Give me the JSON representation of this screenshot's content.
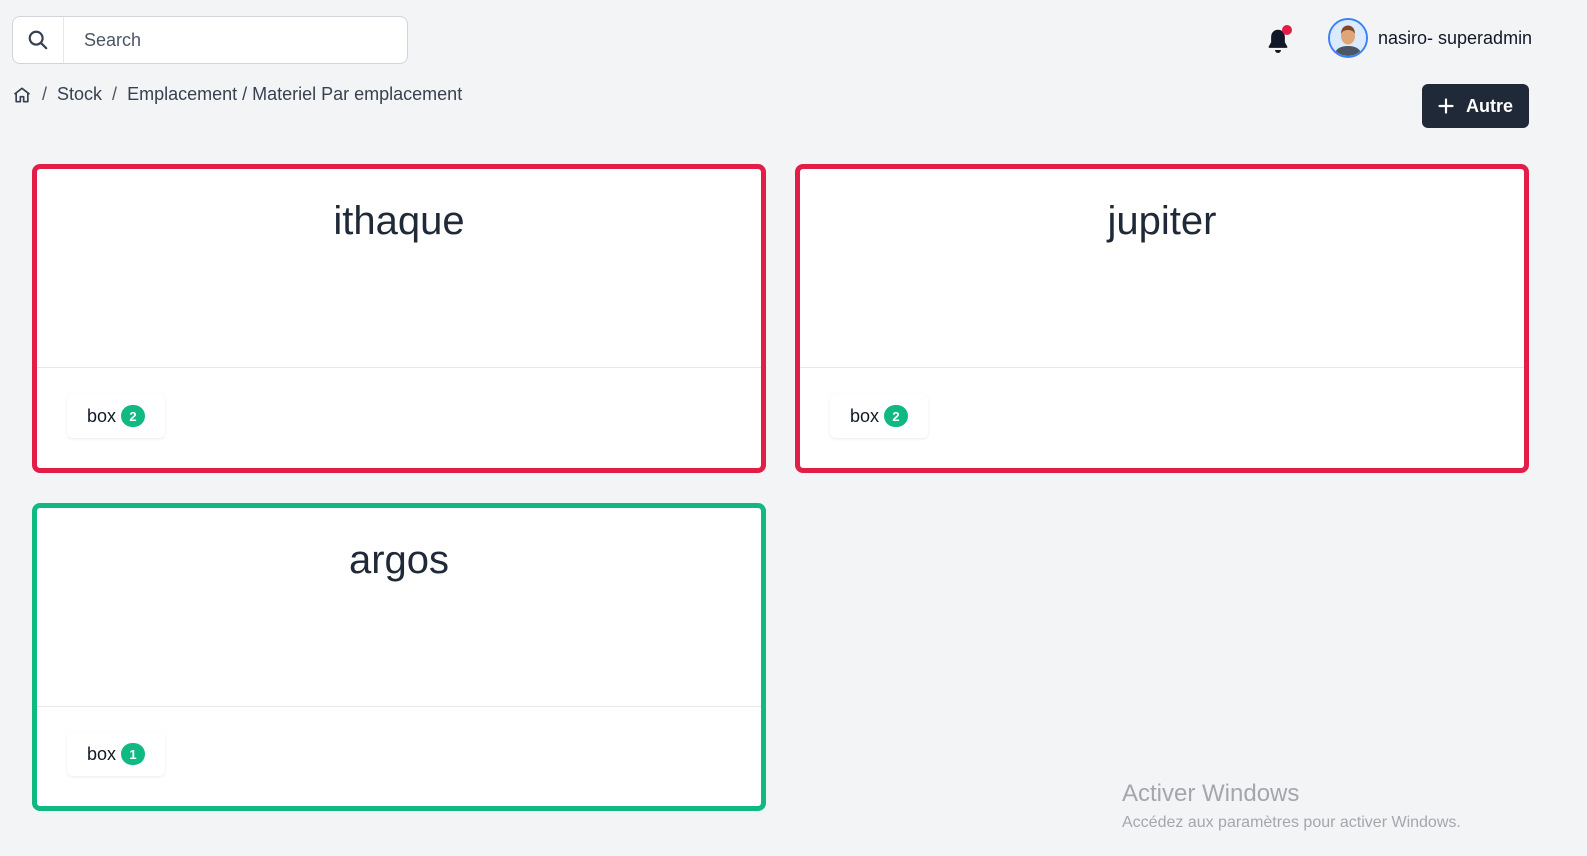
{
  "search": {
    "placeholder": "Search",
    "icon": "search-icon"
  },
  "header": {
    "notification_icon": "bell-icon",
    "notification_dot_color": "#e11d48",
    "user_name": "nasiro- superadmin"
  },
  "breadcrumb": {
    "home_icon": "home-icon",
    "sep1": "/",
    "item1": "Stock",
    "sep2": "/",
    "item2": "Emplacement / Materiel Par emplacement"
  },
  "actions": {
    "add_label": "Autre",
    "add_icon": "plus-icon"
  },
  "cards": [
    {
      "title": "ithaque",
      "chip_label": "box",
      "count": "2",
      "border_color": "#e11d48"
    },
    {
      "title": "jupiter",
      "chip_label": "box",
      "count": "2",
      "border_color": "#e11d48"
    },
    {
      "title": "argos",
      "chip_label": "box",
      "count": "1",
      "border_color": "#10b981"
    }
  ],
  "watermark": {
    "line1": "Activer Windows",
    "line2": "Accédez aux paramètres pour activer Windows."
  }
}
